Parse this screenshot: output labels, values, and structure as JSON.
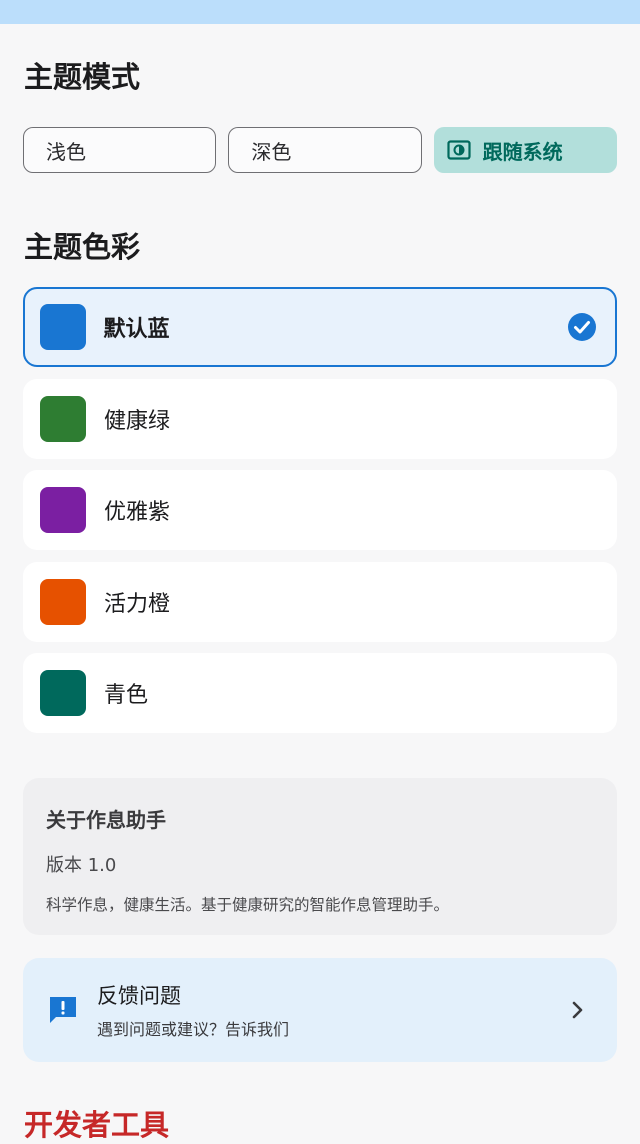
{
  "theme_mode": {
    "title": "主题模式",
    "options": [
      {
        "label": "浅色",
        "active": false
      },
      {
        "label": "深色",
        "active": false
      },
      {
        "label": "跟随系统",
        "active": true,
        "icon": "brightness-auto-icon"
      }
    ]
  },
  "theme_color": {
    "title": "主题色彩",
    "items": [
      {
        "name": "默认蓝",
        "color": "#1976d2",
        "selected": true
      },
      {
        "name": "健康绿",
        "color": "#2e7d32",
        "selected": false
      },
      {
        "name": "优雅紫",
        "color": "#7b1fa2",
        "selected": false
      },
      {
        "name": "活力橙",
        "color": "#e65100",
        "selected": false
      },
      {
        "name": "青色",
        "color": "#00695c",
        "selected": false
      }
    ]
  },
  "about": {
    "title": "关于作息助手",
    "version": "版本 1.0",
    "description": "科学作息，健康生活。基于健康研究的智能作息管理助手。"
  },
  "feedback": {
    "title": "反馈问题",
    "subtitle": "遇到问题或建议？告诉我们",
    "icon": "feedback-icon"
  },
  "developer": {
    "title": "开发者工具"
  },
  "colors": {
    "accent": "#1976d2",
    "mode_active_bg": "#b2dfdb",
    "mode_active_text": "#00695c",
    "developer_title": "#c62828"
  }
}
